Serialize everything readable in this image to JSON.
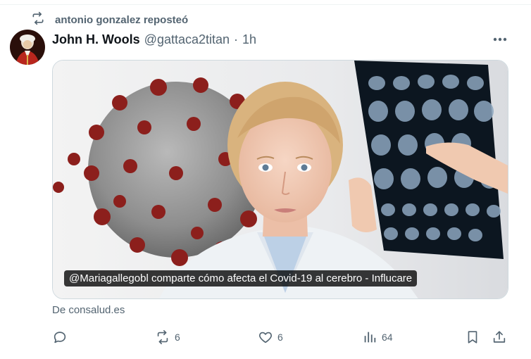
{
  "repost": {
    "label": "antonio gonzalez reposteó",
    "icon": "repost-icon"
  },
  "tweet": {
    "author_name": "John H. Wools",
    "handle": "@gattaca2titan",
    "separator": "·",
    "time": "1h",
    "media": {
      "caption": "@Mariagallegobl comparte cómo afecta el Covid-19 al cerebro - Influcare",
      "source": "De consalud.es"
    },
    "actions": {
      "reply": {
        "icon": "reply-icon",
        "count": ""
      },
      "retweet": {
        "icon": "retweet-icon",
        "count": "6"
      },
      "like": {
        "icon": "heart-icon",
        "count": "6"
      },
      "views": {
        "icon": "views-icon",
        "count": "64"
      },
      "bookmark": {
        "icon": "bookmark-icon"
      },
      "share": {
        "icon": "share-icon"
      }
    }
  },
  "colors": {
    "text": "#0f1419",
    "secondary": "#536471",
    "border": "#cfd9de"
  }
}
